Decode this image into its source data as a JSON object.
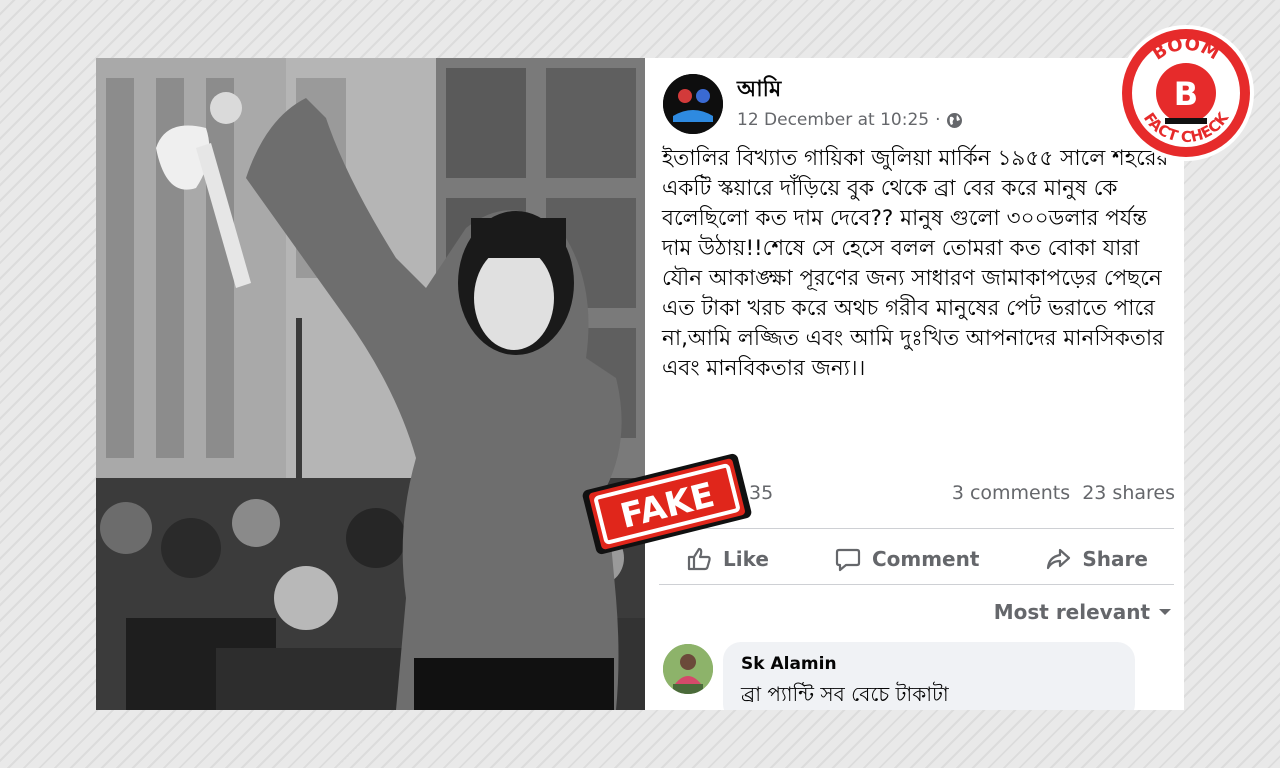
{
  "post": {
    "page_name": "আমি",
    "timestamp": "12 December at 10:25",
    "separator": "·",
    "text": "ইতালির বিখ্যাত গায়িকা জুলিয়া মার্কিন ১৯৫৫ সালে শহরের একটি স্কয়ারে দাঁড়িয়ে বুক থেকে ব্রা বের করে মানুষ কে বলেছিলো কত দাম দেবে?? মানুষ গুলো ৩০০ডলার পর্যন্ত দাম উঠায়!!শেষে সে হেসে বলল তোমরা কত বোকা যারা যৌন আকাঙ্ক্ষা পূরণের জন্য সাধারণ জামাকাপড়ের পেছনে এত টাকা খরচ করে অথচ গরীব মানুষের পেট ভরাতে পারে না,আমি লজ্জিত এবং আমি দুঃখিত আপনাদের মানসিকতার এবং মানবিকতার জন্য।।",
    "reactions_count": "35",
    "comments_count": "3 comments",
    "shares_count": "23 shares"
  },
  "actions": {
    "like": "Like",
    "comment": "Comment",
    "share": "Share"
  },
  "comments_sort": "Most relevant",
  "comment": {
    "author": "Sk Alamin",
    "text": "ব্রা প্যান্টি সব বেচে টাকাটা"
  },
  "stamps": {
    "fake": "FAKE",
    "boom_top": "BOOM",
    "boom_letter": "B",
    "boom_bottom": "FACT CHECK"
  },
  "colors": {
    "fake_red": "#e0261b",
    "boom_red": "#e62b2b",
    "meta_gray": "#65676b",
    "text_dark": "#050505",
    "comment_bg": "#f0f2f5"
  },
  "icons": [
    "globe-icon",
    "like-icon",
    "comment-icon",
    "share-icon",
    "chevron-down-icon"
  ]
}
